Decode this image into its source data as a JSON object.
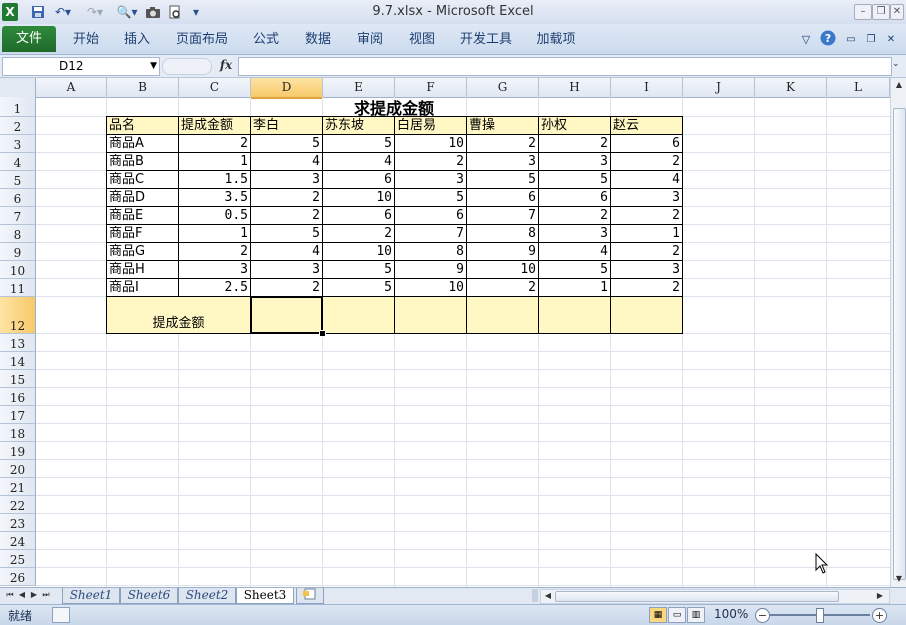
{
  "window": {
    "title": "9.7.xlsx - Microsoft Excel",
    "controls": [
      "minimize",
      "restore",
      "close"
    ]
  },
  "ribbon": {
    "file_tab": "文件",
    "tabs": [
      "开始",
      "插入",
      "页面布局",
      "公式",
      "数据",
      "审阅",
      "视图",
      "开发工具",
      "加载项"
    ]
  },
  "formula_bar": {
    "name_box": "D12",
    "fx_label": "fx",
    "content": ""
  },
  "columns": [
    "A",
    "B",
    "C",
    "D",
    "E",
    "F",
    "G",
    "H",
    "I",
    "J",
    "K",
    "L"
  ],
  "selected_column": "D",
  "rows": [
    "1",
    "2",
    "3",
    "4",
    "5",
    "6",
    "7",
    "8",
    "9",
    "10",
    "11",
    "12",
    "13",
    "14",
    "15",
    "16",
    "17",
    "18",
    "19",
    "20",
    "21",
    "22",
    "23",
    "24",
    "25",
    "26"
  ],
  "selected_row": "12",
  "sheet": {
    "title": "求提成金额",
    "headers": [
      "品名",
      "提成金额",
      "李白",
      "苏东坡",
      "白居易",
      "曹操",
      "孙权",
      "赵云"
    ],
    "data": [
      [
        "商品A",
        "2",
        "5",
        "5",
        "10",
        "2",
        "2",
        "6"
      ],
      [
        "商品B",
        "1",
        "4",
        "4",
        "2",
        "3",
        "3",
        "2"
      ],
      [
        "商品C",
        "1.5",
        "3",
        "6",
        "3",
        "5",
        "5",
        "4"
      ],
      [
        "商品D",
        "3.5",
        "2",
        "10",
        "5",
        "6",
        "6",
        "3"
      ],
      [
        "商品E",
        "0.5",
        "2",
        "6",
        "6",
        "7",
        "2",
        "2"
      ],
      [
        "商品F",
        "1",
        "5",
        "2",
        "7",
        "8",
        "3",
        "1"
      ],
      [
        "商品G",
        "2",
        "4",
        "10",
        "8",
        "9",
        "4",
        "2"
      ],
      [
        "商品H",
        "3",
        "3",
        "5",
        "9",
        "10",
        "5",
        "3"
      ],
      [
        "商品I",
        "2.5",
        "2",
        "5",
        "10",
        "2",
        "1",
        "2"
      ]
    ],
    "total_label": "提成金额"
  },
  "sheet_tabs": [
    "Sheet1",
    "Sheet6",
    "Sheet2",
    "Sheet3"
  ],
  "active_sheet": "Sheet3",
  "status": {
    "ready": "就绪",
    "zoom": "100%"
  },
  "icons": [
    "excel-logo-icon",
    "save-icon",
    "undo-icon",
    "redo-icon",
    "camera-icon",
    "print-preview-icon",
    "help-icon",
    "new-sheet-icon",
    "mouse-cursor-icon"
  ]
}
